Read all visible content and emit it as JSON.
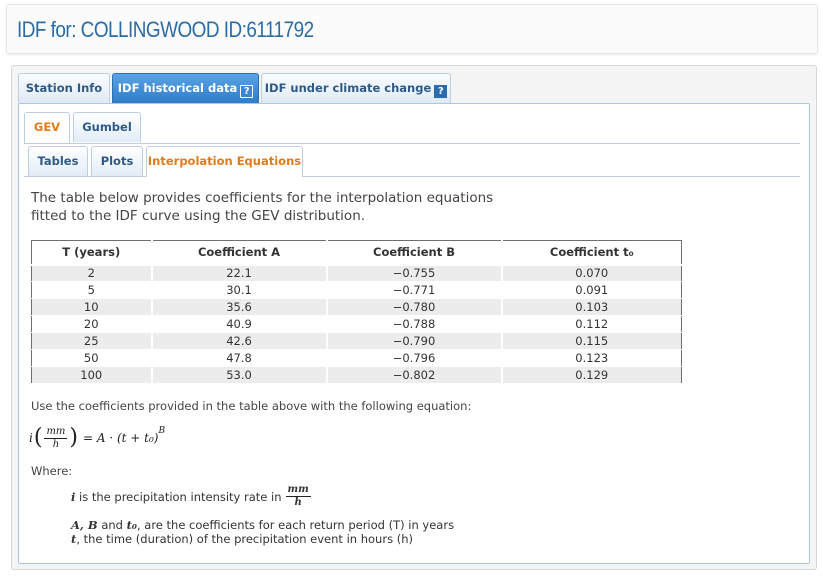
{
  "header": {
    "title": "IDF for: COLLINGWOOD ID:6111792"
  },
  "top_tabs": [
    {
      "label": "Station Info",
      "active": false
    },
    {
      "label": "IDF historical data",
      "active": true,
      "help": "?"
    },
    {
      "label": "IDF under climate change",
      "active": false,
      "help": "?"
    }
  ],
  "dist_tabs": [
    {
      "label": "GEV",
      "active": true
    },
    {
      "label": "Gumbel",
      "active": false
    }
  ],
  "view_tabs": [
    {
      "label": "Tables",
      "active": false
    },
    {
      "label": "Plots",
      "active": false
    },
    {
      "label": "Interpolation Equations",
      "active": true
    }
  ],
  "intro": {
    "line1": "The table below provides coefficients for the interpolation equations",
    "line2": "fitted to the IDF curve using the GEV distribution."
  },
  "table": {
    "headers": [
      "T (years)",
      "Coefficient A",
      "Coefficient B",
      "Coefficient t₀"
    ],
    "rows": [
      [
        "2",
        "22.1",
        "−0.755",
        "0.070"
      ],
      [
        "5",
        "30.1",
        "−0.771",
        "0.091"
      ],
      [
        "10",
        "35.6",
        "−0.780",
        "0.103"
      ],
      [
        "20",
        "40.9",
        "−0.788",
        "0.112"
      ],
      [
        "25",
        "42.6",
        "−0.790",
        "0.115"
      ],
      [
        "50",
        "47.8",
        "−0.796",
        "0.123"
      ],
      [
        "100",
        "53.0",
        "−0.802",
        "0.129"
      ]
    ]
  },
  "equation": {
    "intro": "Use the coefficients provided in the table above with the following equation:",
    "lhs": "i",
    "unit_num": "mm",
    "unit_den": "h",
    "rhs": "= A · (t + t₀)",
    "exponent": "B"
  },
  "where": {
    "label": "Where:",
    "def1_sym": "i",
    "def1_text": "is the precipitation intensity rate in",
    "def1_unit_num": "mm",
    "def1_unit_den": "h",
    "def2_sym": "A, B",
    "def2_and": "and",
    "def2_sym2": "t₀",
    "def2_text": ", are the coefficients for each return period (T) in years",
    "def3_sym": "t",
    "def3_text": ", the time (duration) of the precipitation event in hours (h)"
  }
}
